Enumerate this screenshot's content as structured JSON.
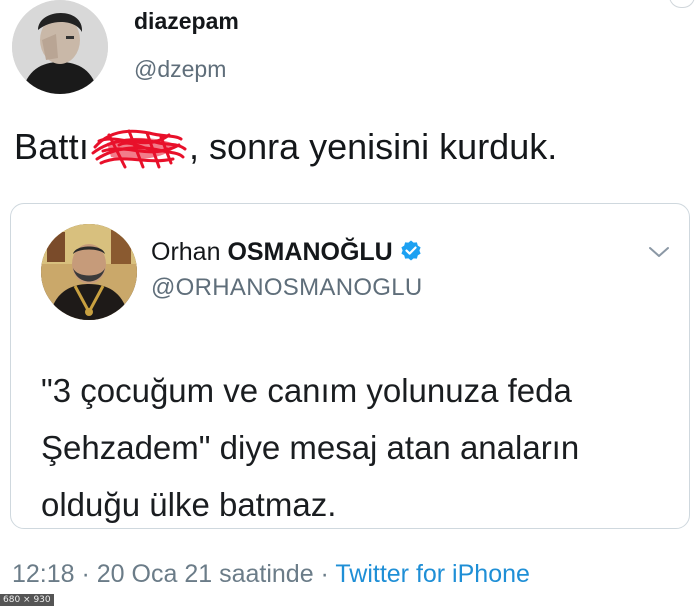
{
  "tweet": {
    "author_name": "diazepam",
    "author_handle": "@dzepm",
    "text_before": "Battı",
    "text_after": ", sonra yenisini kurduk.",
    "timestamp": "12:18 · 20 Oca 21 saatinde",
    "separator": " · ",
    "source": "Twitter for iPhone"
  },
  "quoted_tweet": {
    "name_first": "Orhan ",
    "name_last": "OSMANOĞLU",
    "handle": "@ORHANOSMANOGLU",
    "verified": true,
    "lines": [
      "\"3 çocuğum ve canım yolunuza feda",
      "Şehzadem\" diye mesaj atan anaların",
      "olduğu ülke batmaz."
    ]
  },
  "image_size_badge": "680 × 930",
  "colors": {
    "text": "#14171a",
    "secondary": "#5f6e7a",
    "link": "#1f8fd6",
    "verified": "#1da1f2",
    "redaction": "#e8102a",
    "border": "#cfd8de"
  },
  "icons": [
    "verified-badge-icon",
    "chevron-down-icon"
  ]
}
